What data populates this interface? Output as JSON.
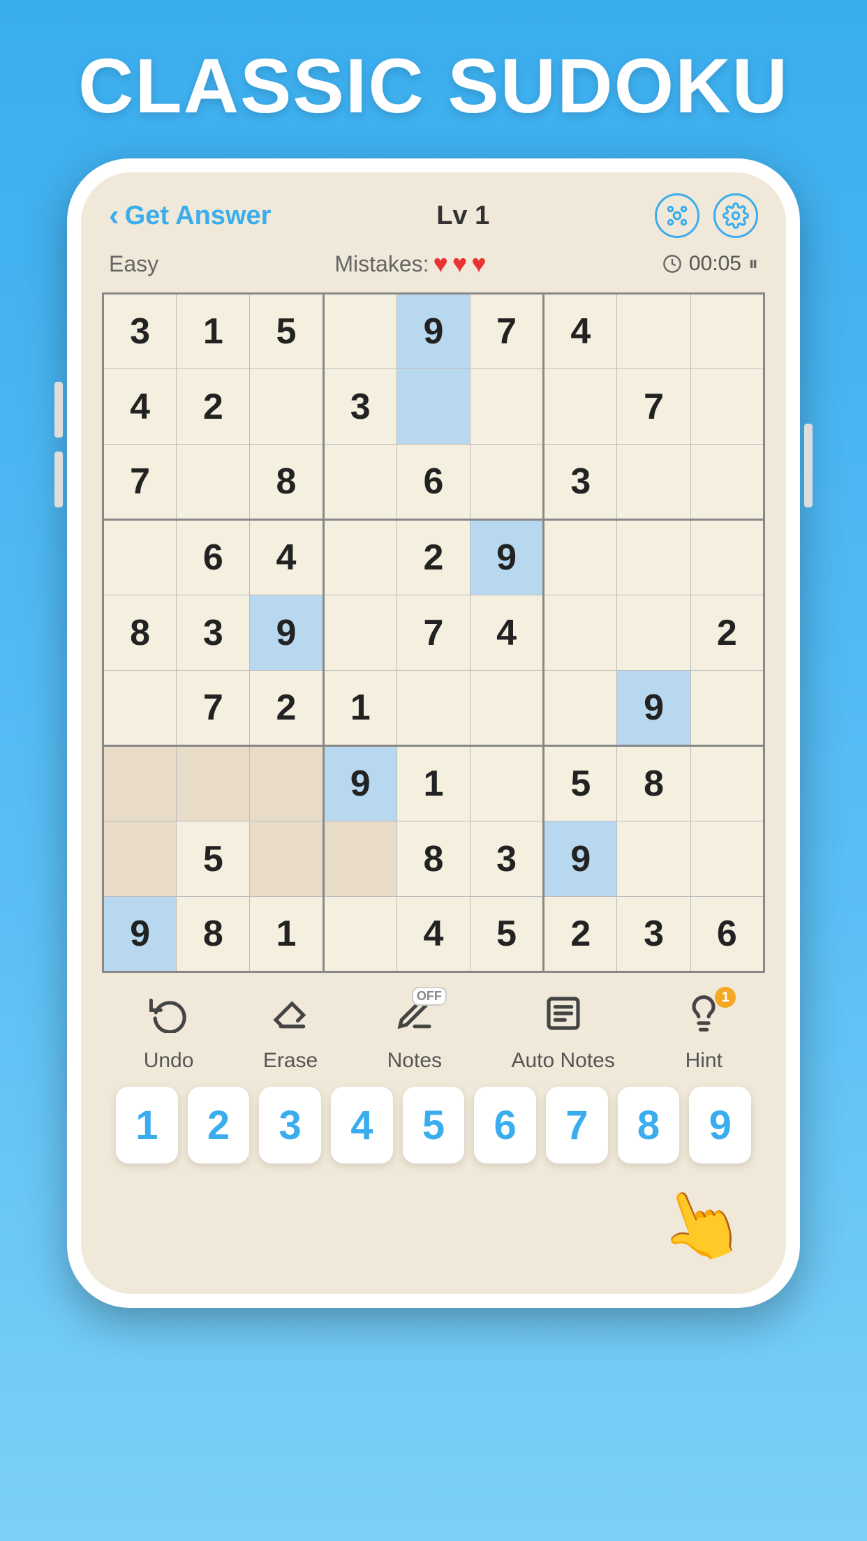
{
  "app": {
    "title": "CLASSIC SUDOKU"
  },
  "header": {
    "back_label": "Get Answer",
    "level": "Lv 1",
    "difficulty": "Easy",
    "mistakes_label": "Mistakes:",
    "hearts": 3,
    "timer": "00:05"
  },
  "grid": {
    "cells": [
      [
        "3",
        "1",
        "5",
        "",
        "9",
        "7",
        "4",
        "",
        ""
      ],
      [
        "4",
        "2",
        "",
        "3",
        "",
        "",
        "",
        "7",
        ""
      ],
      [
        "7",
        "",
        "8",
        "",
        "6",
        "",
        "3",
        "",
        ""
      ],
      [
        "",
        "6",
        "4",
        "",
        "2",
        "9",
        "",
        "",
        ""
      ],
      [
        "8",
        "3",
        "9",
        "",
        "7",
        "4",
        "",
        "",
        "2"
      ],
      [
        "",
        "7",
        "2",
        "1",
        "",
        "",
        "",
        "9",
        ""
      ],
      [
        "",
        "",
        "",
        "9",
        "1",
        "",
        "5",
        "8",
        ""
      ],
      [
        "",
        "5",
        "",
        "",
        "8",
        "3",
        "9",
        "",
        ""
      ],
      [
        "9",
        "8",
        "1",
        "",
        "4",
        "5",
        "2",
        "3",
        "6"
      ]
    ],
    "highlighted_cells": [
      [
        0,
        4
      ],
      [
        1,
        4
      ],
      [
        3,
        5
      ],
      [
        4,
        2
      ],
      [
        5,
        7
      ],
      [
        6,
        3
      ],
      [
        7,
        6
      ],
      [
        8,
        0
      ]
    ],
    "beige_cells": [
      [
        6,
        0
      ],
      [
        6,
        1
      ],
      [
        6,
        2
      ],
      [
        7,
        0
      ],
      [
        7,
        2
      ],
      [
        7,
        3
      ]
    ]
  },
  "toolbar": {
    "undo_label": "Undo",
    "erase_label": "Erase",
    "notes_label": "Notes",
    "notes_state": "OFF",
    "auto_notes_label": "Auto Notes",
    "hint_label": "Hint",
    "hint_count": "1"
  },
  "number_pad": {
    "numbers": [
      "1",
      "2",
      "3",
      "4",
      "5",
      "6",
      "7",
      "8",
      "9"
    ]
  }
}
